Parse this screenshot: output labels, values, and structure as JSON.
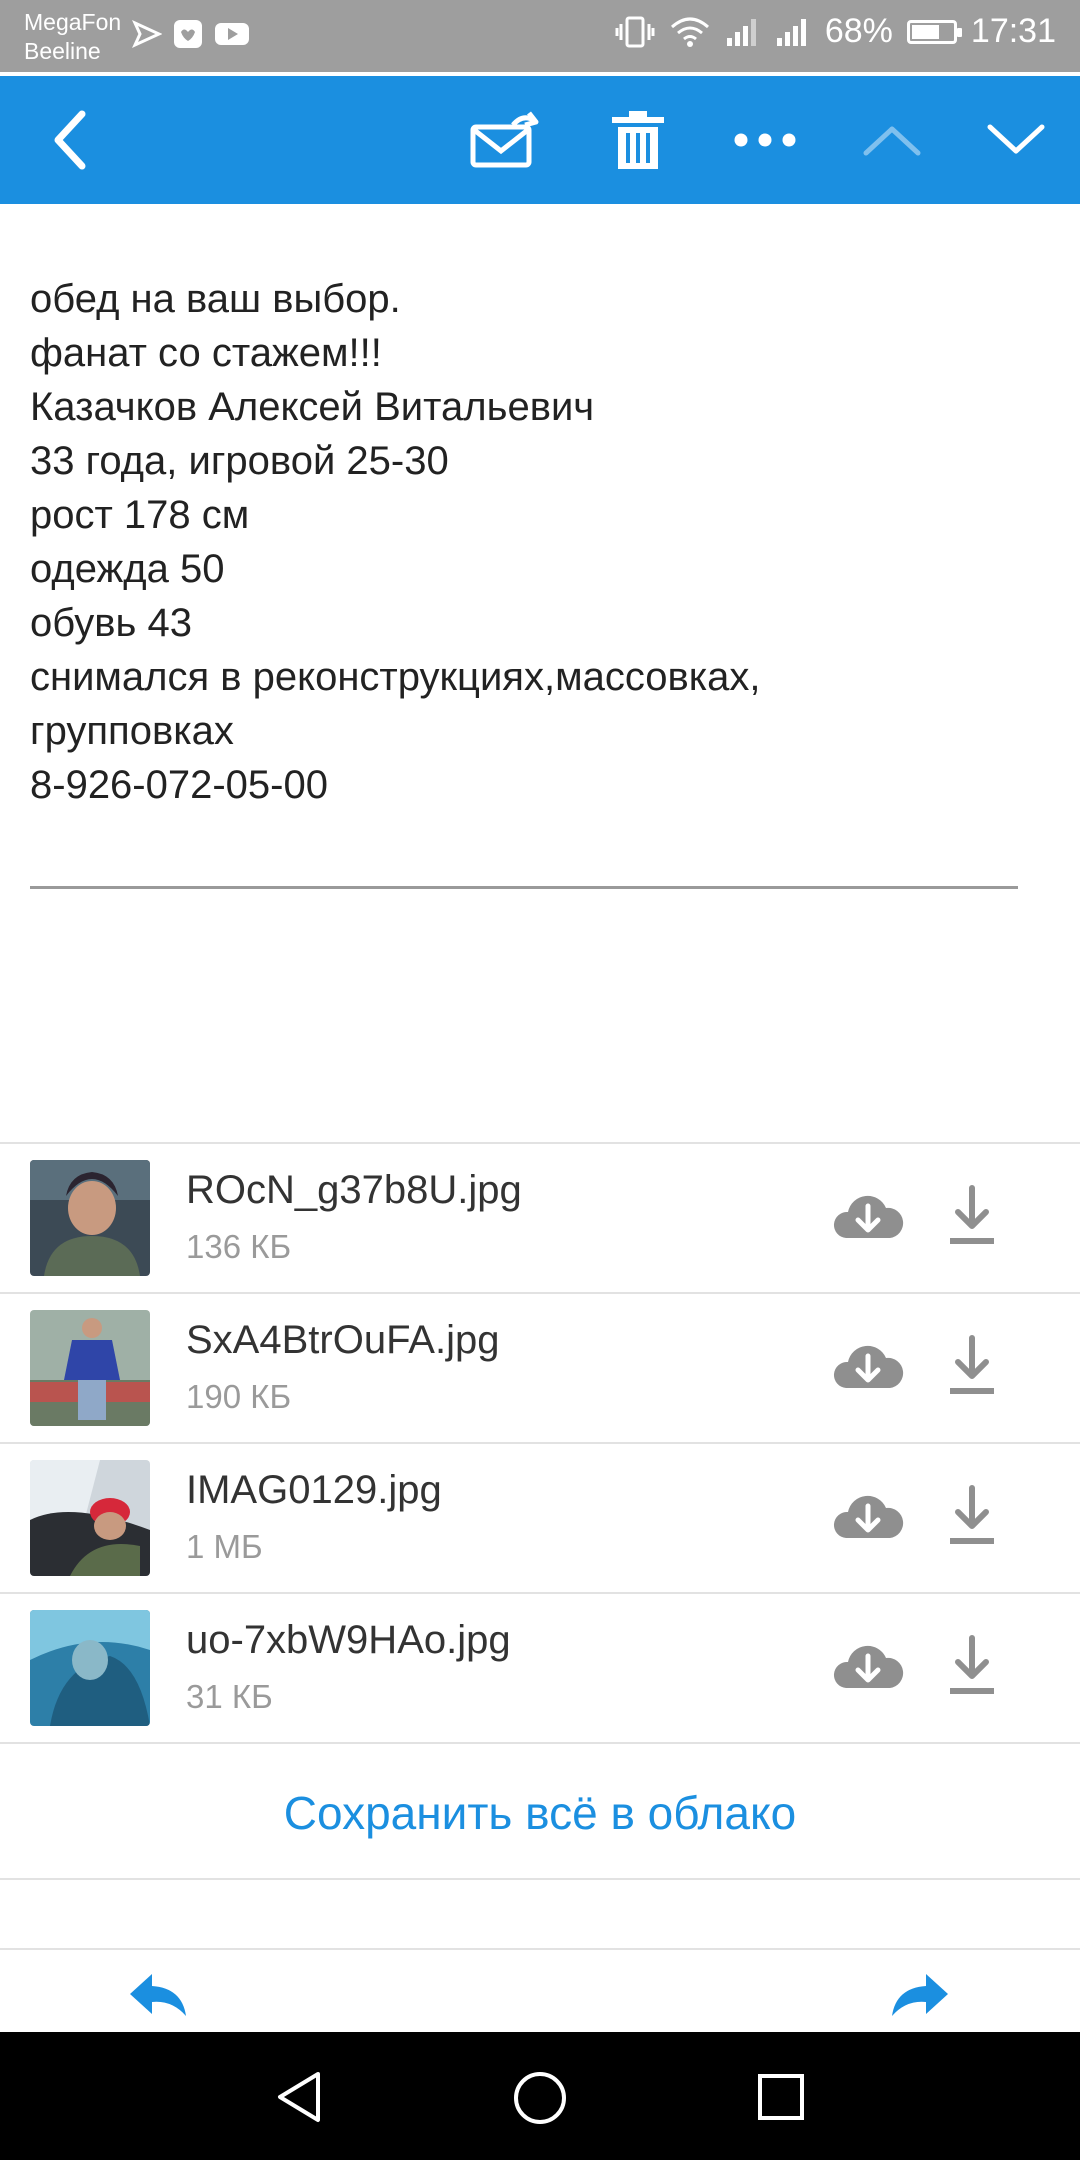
{
  "status_bar": {
    "carrier_1": "MegaFon",
    "carrier_2": "Beeline",
    "battery": "68%",
    "battery_level": 0.68,
    "time": "17:31"
  },
  "toolbar": {
    "icons": [
      "back-arrow-icon",
      "mark-unread-icon",
      "trash-icon",
      "more-icon",
      "chevron-up-icon",
      "chevron-down-icon"
    ],
    "accent": "#1b8fe0"
  },
  "mail": {
    "lines": [
      "обед на ваш выбор.",
      "фанат со стажем!!!",
      "Казачков Алексей Витальевич",
      "33 года, игровой 25-30",
      "рост 178 см",
      "одежда 50",
      "обувь 43",
      "снимался в реконструкциях,массовках,",
      "групповках",
      "8-926-072-05-00"
    ]
  },
  "attachments": [
    {
      "name": "ROcN_g37b8U.jpg",
      "size": "136 КБ"
    },
    {
      "name": "SxA4BtrOuFA.jpg",
      "size": "190 КБ"
    },
    {
      "name": "IMAG0129.jpg",
      "size": "1 МБ"
    },
    {
      "name": "uo-7xbW9HAo.jpg",
      "size": "31 КБ"
    }
  ],
  "save_all_label": "Сохранить всё в облако",
  "bottom_actions": {
    "icons": [
      "reply-icon",
      "forward-icon"
    ]
  },
  "nav_bar": {
    "icons": [
      "nav-back-icon",
      "nav-home-icon",
      "nav-recents-icon"
    ]
  }
}
